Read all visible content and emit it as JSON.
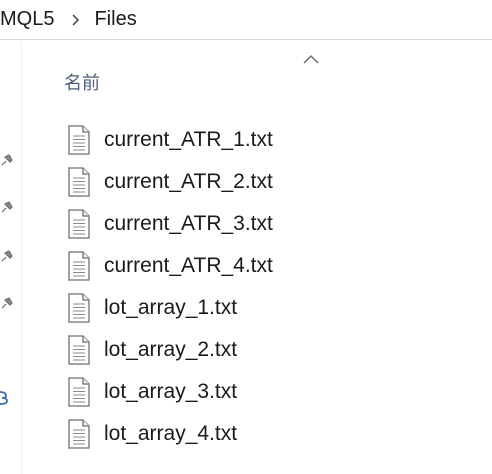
{
  "breadcrumb": {
    "items": [
      "MQL5",
      "Files"
    ]
  },
  "header": {
    "name_column": "名前"
  },
  "files": [
    "current_ATR_1.txt",
    "current_ATR_2.txt",
    "current_ATR_3.txt",
    "current_ATR_4.txt",
    "lot_array_1.txt",
    "lot_array_2.txt",
    "lot_array_3.txt",
    "lot_array_4.txt"
  ],
  "icons": {
    "breadcrumb_separator": "chevron-right-icon",
    "sort": "chevron-up-icon",
    "file": "text-file-icon",
    "pin": "pin-icon"
  },
  "colors": {
    "text": "#1a1a1a",
    "header_text": "#4c607a",
    "divider": "#d9d9d9"
  }
}
